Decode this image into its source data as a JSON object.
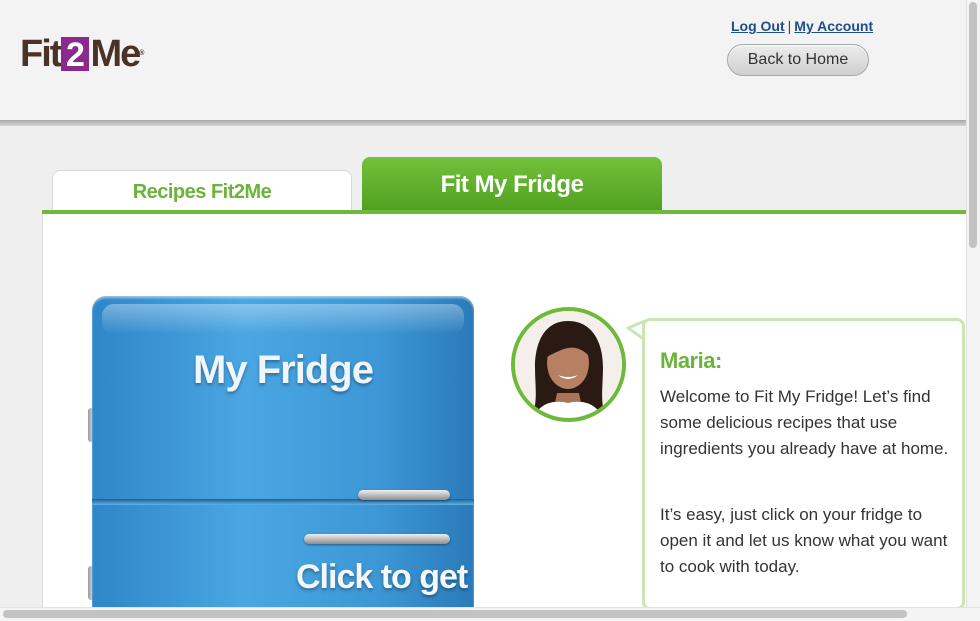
{
  "header": {
    "logo_prefix": "Fit",
    "logo_number": "2",
    "logo_suffix": "Me",
    "logo_tm": "®",
    "logout_label": "Log Out",
    "separator": "|",
    "account_label": "My Account",
    "back_label": "Back to Home"
  },
  "tabs": [
    {
      "label": "Recipes Fit2Me",
      "active": false
    },
    {
      "label": "Fit My Fridge",
      "active": true
    }
  ],
  "fridge": {
    "title": "My Fridge",
    "cta": "Click to get"
  },
  "assistant": {
    "name": "Maria:",
    "message_1": "Welcome to Fit My Fridge! Let’s find some delicious recipes that use ingredients you already have at home.",
    "message_2": "It’s easy, just click on your fridge to open it and let us know what you want to cook with today."
  },
  "colors": {
    "accent_green": "#6bb33a",
    "brand_purple": "#8a2a8c",
    "brand_brown": "#4a3226",
    "fridge_blue": "#3d97d6",
    "link_blue": "#1f4f87"
  },
  "icons": [
    "fridge-illustration",
    "avatar-portrait"
  ]
}
